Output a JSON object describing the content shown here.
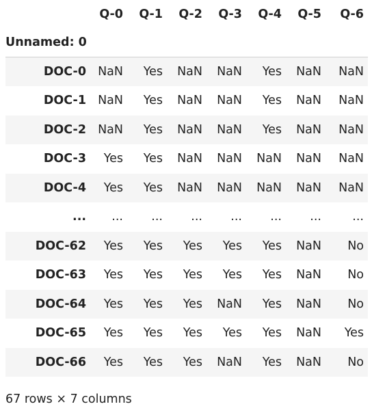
{
  "table": {
    "index_name": "Unnamed: 0",
    "columns": [
      "Q-0",
      "Q-1",
      "Q-2",
      "Q-3",
      "Q-4",
      "Q-5",
      "Q-6"
    ],
    "rows": [
      {
        "index": "DOC-0",
        "values": [
          "NaN",
          "Yes",
          "NaN",
          "NaN",
          "Yes",
          "NaN",
          "NaN"
        ]
      },
      {
        "index": "DOC-1",
        "values": [
          "NaN",
          "Yes",
          "NaN",
          "NaN",
          "Yes",
          "NaN",
          "NaN"
        ]
      },
      {
        "index": "DOC-2",
        "values": [
          "NaN",
          "Yes",
          "NaN",
          "NaN",
          "Yes",
          "NaN",
          "NaN"
        ]
      },
      {
        "index": "DOC-3",
        "values": [
          "Yes",
          "Yes",
          "NaN",
          "NaN",
          "NaN",
          "NaN",
          "NaN"
        ]
      },
      {
        "index": "DOC-4",
        "values": [
          "Yes",
          "Yes",
          "NaN",
          "NaN",
          "NaN",
          "NaN",
          "NaN"
        ]
      },
      {
        "index": "...",
        "values": [
          "...",
          "...",
          "...",
          "...",
          "...",
          "...",
          "..."
        ]
      },
      {
        "index": "DOC-62",
        "values": [
          "Yes",
          "Yes",
          "Yes",
          "Yes",
          "Yes",
          "NaN",
          "No"
        ]
      },
      {
        "index": "DOC-63",
        "values": [
          "Yes",
          "Yes",
          "Yes",
          "Yes",
          "Yes",
          "NaN",
          "No"
        ]
      },
      {
        "index": "DOC-64",
        "values": [
          "Yes",
          "Yes",
          "Yes",
          "NaN",
          "Yes",
          "NaN",
          "No"
        ]
      },
      {
        "index": "DOC-65",
        "values": [
          "Yes",
          "Yes",
          "Yes",
          "Yes",
          "Yes",
          "NaN",
          "Yes"
        ]
      },
      {
        "index": "DOC-66",
        "values": [
          "Yes",
          "Yes",
          "Yes",
          "NaN",
          "Yes",
          "NaN",
          "No"
        ]
      }
    ]
  },
  "footer": {
    "shape_text": "67 rows × 7 columns"
  },
  "colors": {
    "striped_row": "#f5f5f5",
    "text": "#222222",
    "header_rule": "#cfcfcf"
  }
}
